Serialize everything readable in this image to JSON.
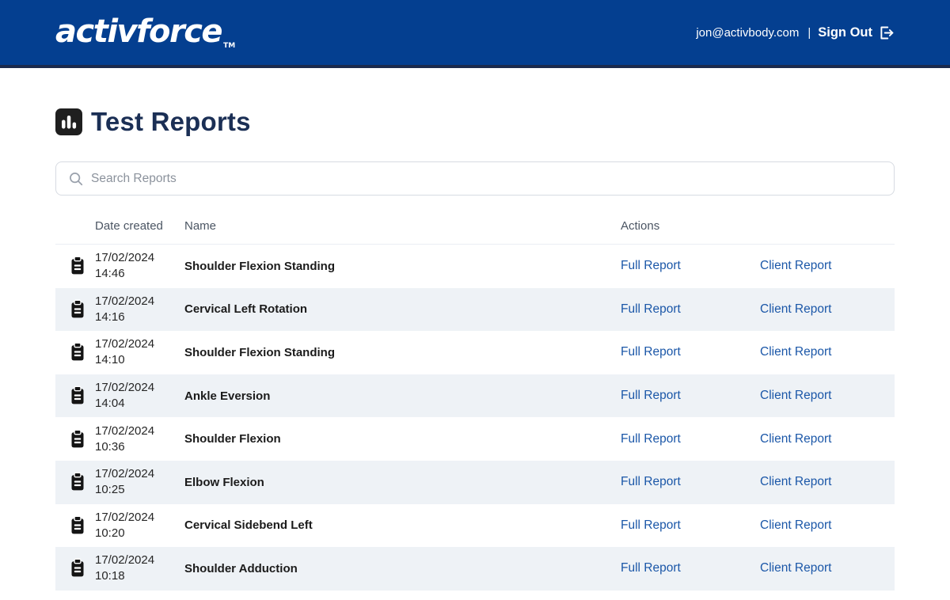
{
  "header": {
    "logo_text": "activforce",
    "logo_tm": "TM",
    "user_email": "jon@activbody.com",
    "separator": "|",
    "sign_out_label": "Sign Out"
  },
  "page": {
    "title": "Test Reports"
  },
  "search": {
    "placeholder": "Search Reports"
  },
  "table": {
    "columns": {
      "date": "Date created",
      "name": "Name",
      "actions": "Actions"
    },
    "action_labels": {
      "full": "Full Report",
      "client": "Client Report"
    },
    "rows": [
      {
        "date": "17/02/2024",
        "time": "14:46",
        "name": "Shoulder Flexion Standing"
      },
      {
        "date": "17/02/2024",
        "time": "14:16",
        "name": "Cervical Left Rotation"
      },
      {
        "date": "17/02/2024",
        "time": "14:10",
        "name": "Shoulder Flexion Standing"
      },
      {
        "date": "17/02/2024",
        "time": "14:04",
        "name": "Ankle Eversion"
      },
      {
        "date": "17/02/2024",
        "time": "10:36",
        "name": "Shoulder Flexion"
      },
      {
        "date": "17/02/2024",
        "time": "10:25",
        "name": "Elbow Flexion"
      },
      {
        "date": "17/02/2024",
        "time": "10:20",
        "name": "Cervical Sidebend Left"
      },
      {
        "date": "17/02/2024",
        "time": "10:18",
        "name": "Shoulder Adduction"
      }
    ]
  },
  "colors": {
    "header_blue": "#043f90",
    "header_border": "#1b2a4d",
    "link_blue": "#1b57a8",
    "row_alt": "#eef2f6",
    "title_navy": "#1b2f55"
  }
}
